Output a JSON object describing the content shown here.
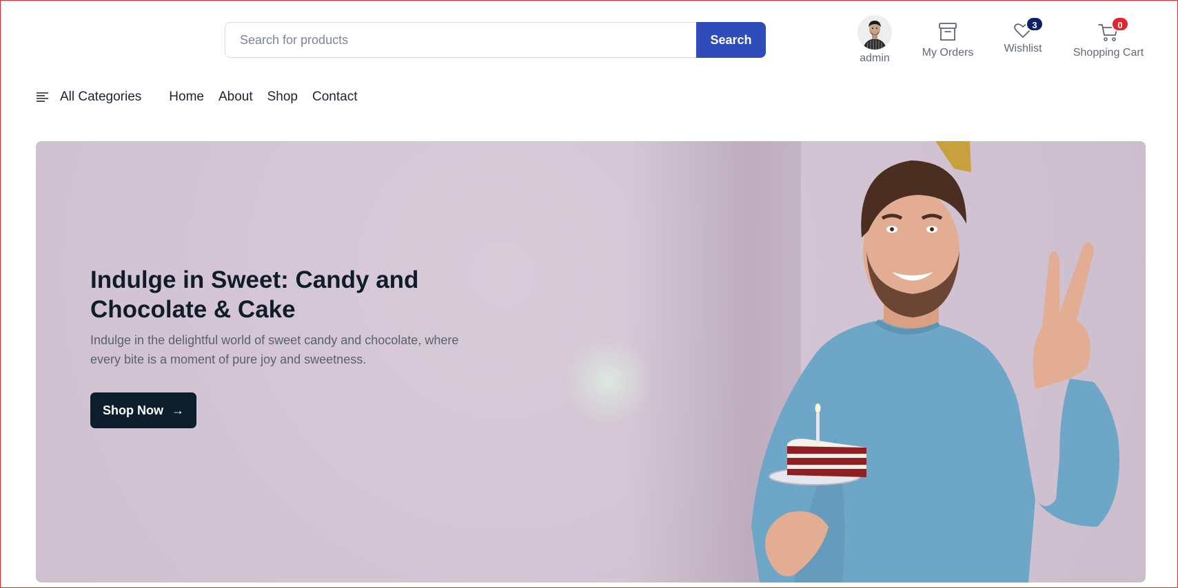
{
  "header": {
    "search": {
      "placeholder": "Search for products",
      "value": "",
      "button_label": "Search"
    },
    "account": {
      "label": "admin",
      "icon": "avatar"
    },
    "orders": {
      "label": "My Orders",
      "icon": "archive-box-icon"
    },
    "wishlist": {
      "label": "Wishlist",
      "icon": "heart-icon",
      "count": "3"
    },
    "cart": {
      "label": "Shopping Cart",
      "icon": "cart-icon",
      "count": "0"
    }
  },
  "nav": {
    "categories_label": "All Categories",
    "links": [
      "Home",
      "About",
      "Shop",
      "Contact"
    ]
  },
  "hero": {
    "title": "Indulge in Sweet: Candy and Chocolate & Cake",
    "subtitle": "Indulge in the delightful world of sweet candy and chocolate, where every bite is a moment of pure joy and sweetness.",
    "cta_label": "Shop Now",
    "cta_icon": "arrow-right-icon",
    "image": "man-holding-cake-slice"
  },
  "colors": {
    "accent": "#2f4cb8",
    "cta": "#0c1e2c",
    "wishlist_badge": "#0b2366",
    "cart_badge": "#e0262c",
    "hero_bg": "#d3c5d4"
  }
}
